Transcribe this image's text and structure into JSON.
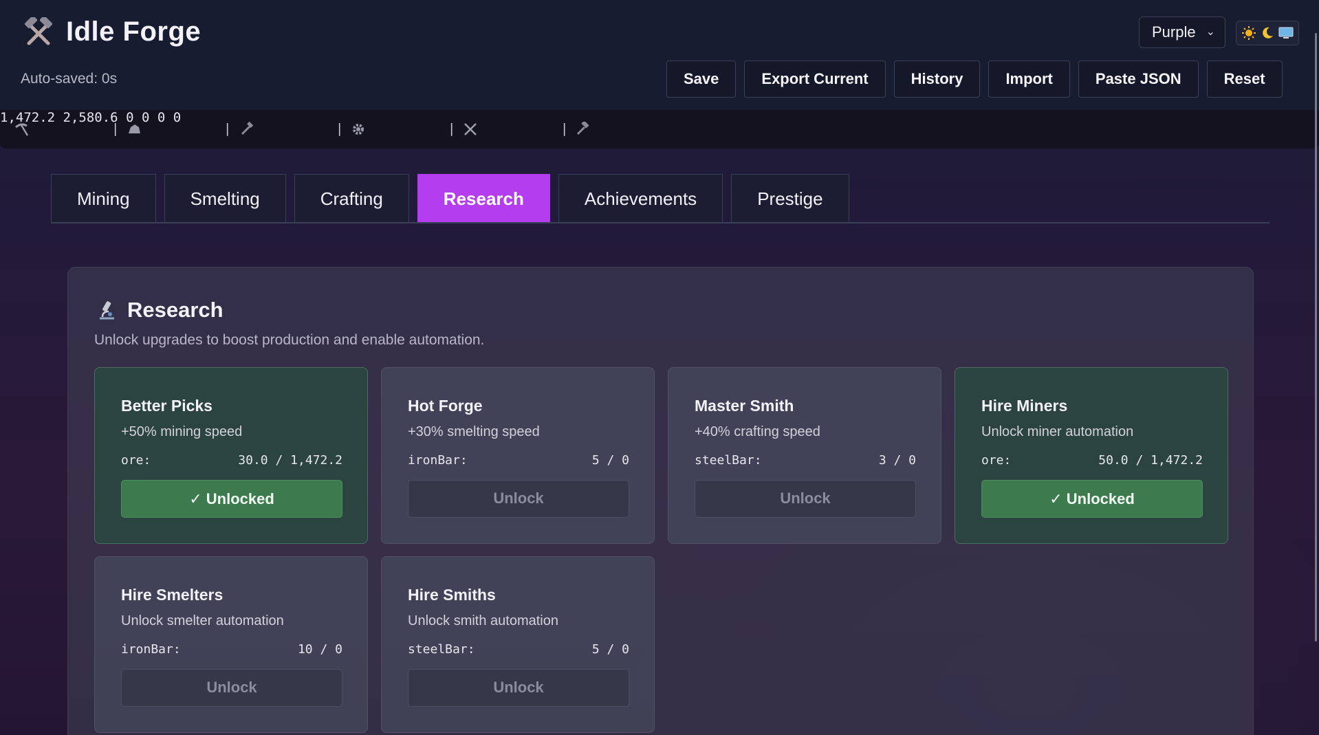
{
  "app": {
    "title": "Idle Forge",
    "autosave": "Auto-saved: 0s"
  },
  "theme": {
    "selected": "Purple",
    "chevron": "⌄",
    "modes": [
      "sun-icon",
      "moon-icon",
      "monitor-icon"
    ]
  },
  "toolbar": {
    "save": "Save",
    "export": "Export Current",
    "history": "History",
    "import": "Import",
    "paste": "Paste JSON",
    "reset": "Reset"
  },
  "resources": [
    {
      "icon": "pickaxe-icon",
      "value": "1,472.2"
    },
    {
      "icon": "ore-icon",
      "value": "2,580.6"
    },
    {
      "icon": "iron-bar-icon",
      "value": "0"
    },
    {
      "icon": "gear-icon",
      "value": "0"
    },
    {
      "icon": "crossed-swords-icon",
      "value": "0"
    },
    {
      "icon": "hammer-icon",
      "value": "0"
    }
  ],
  "separator": "|",
  "tabs": [
    "Mining",
    "Smelting",
    "Crafting",
    "Research",
    "Achievements",
    "Prestige"
  ],
  "active_tab": "Research",
  "research": {
    "title": "Research",
    "subtitle": "Unlock upgrades to boost production and enable automation.",
    "cards": [
      {
        "name": "Better Picks",
        "desc": "+50% mining speed",
        "cost_key": "ore:",
        "cost_val": "30.0 / 1,472.2",
        "button": "✓ Unlocked",
        "unlocked": true
      },
      {
        "name": "Hot Forge",
        "desc": "+30% smelting speed",
        "cost_key": "ironBar:",
        "cost_val": "5 / 0",
        "button": "Unlock",
        "unlocked": false
      },
      {
        "name": "Master Smith",
        "desc": "+40% crafting speed",
        "cost_key": "steelBar:",
        "cost_val": "3 / 0",
        "button": "Unlock",
        "unlocked": false
      },
      {
        "name": "Hire Miners",
        "desc": "Unlock miner automation",
        "cost_key": "ore:",
        "cost_val": "50.0 / 1,472.2",
        "button": "✓ Unlocked",
        "unlocked": true
      },
      {
        "name": "Hire Smelters",
        "desc": "Unlock smelter automation",
        "cost_key": "ironBar:",
        "cost_val": "10 / 0",
        "button": "Unlock",
        "unlocked": false
      },
      {
        "name": "Hire Smiths",
        "desc": "Unlock smith automation",
        "cost_key": "steelBar:",
        "cost_val": "5 / 0",
        "button": "Unlock",
        "unlocked": false
      }
    ]
  },
  "colors": {
    "accent": "#b53df0",
    "unlocked": "#3d7a4e",
    "header_bg": "#171c30"
  }
}
